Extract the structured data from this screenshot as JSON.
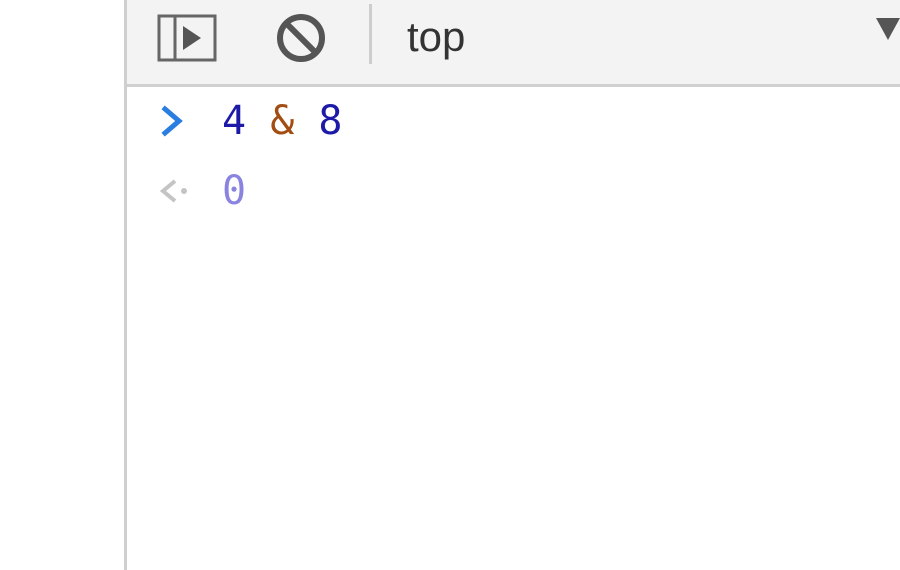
{
  "toolbar": {
    "context_label": "top"
  },
  "console": {
    "input": {
      "left": "4",
      "operator": "&",
      "right": "8"
    },
    "result": "0"
  },
  "colors": {
    "number": "#1d1aa7",
    "operator": "#a24d12",
    "result": "#8a84e0",
    "prompt": "#2a7de1",
    "result_arrow": "#c4c4c4"
  },
  "icons": {
    "sidebar_toggle": "sidebar-toggle-icon",
    "clear": "clear-console-icon",
    "input_prompt": "chevron-right-icon",
    "result_prompt": "result-arrow-icon",
    "dropdown": "dropdown-arrow-icon"
  }
}
